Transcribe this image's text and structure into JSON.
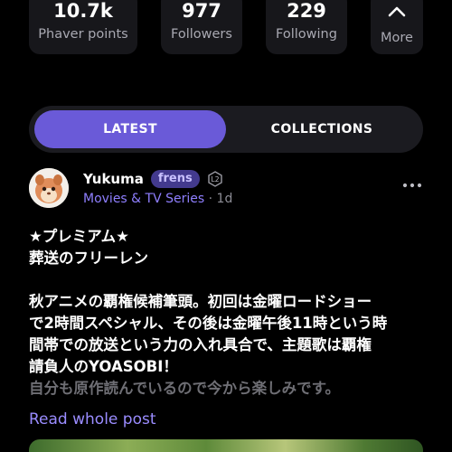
{
  "stats": [
    {
      "value": "10.7k",
      "label": "Phaver points"
    },
    {
      "value": "977",
      "label": "Followers"
    },
    {
      "value": "229",
      "label": "Following"
    }
  ],
  "more": {
    "label": "More",
    "icon": "chevron-up-icon"
  },
  "tabs": {
    "latest": "LATEST",
    "collections": "COLLECTIONS"
  },
  "post": {
    "author": "Yukuma",
    "badge": "frens",
    "level": "L2",
    "category": "Movies & TV Series",
    "time": "· 1d",
    "lines": [
      "★プレミアム★",
      "葬送のフリーレン",
      "秋アニメの覇権候補筆頭。初回は金曜ロードショー",
      "で2時間スペシャル、その後は金曜午後11時という時",
      "間帯での放送という力の入れ具合で、主題歌は覇権",
      "請負人のYOASOBI！",
      "自分も原作読んでいるので今から楽しみです。"
    ],
    "read_more": "Read whole post"
  },
  "colors": {
    "accent": "#6a5ad8",
    "link": "#9a8cff",
    "background": "#000000"
  }
}
